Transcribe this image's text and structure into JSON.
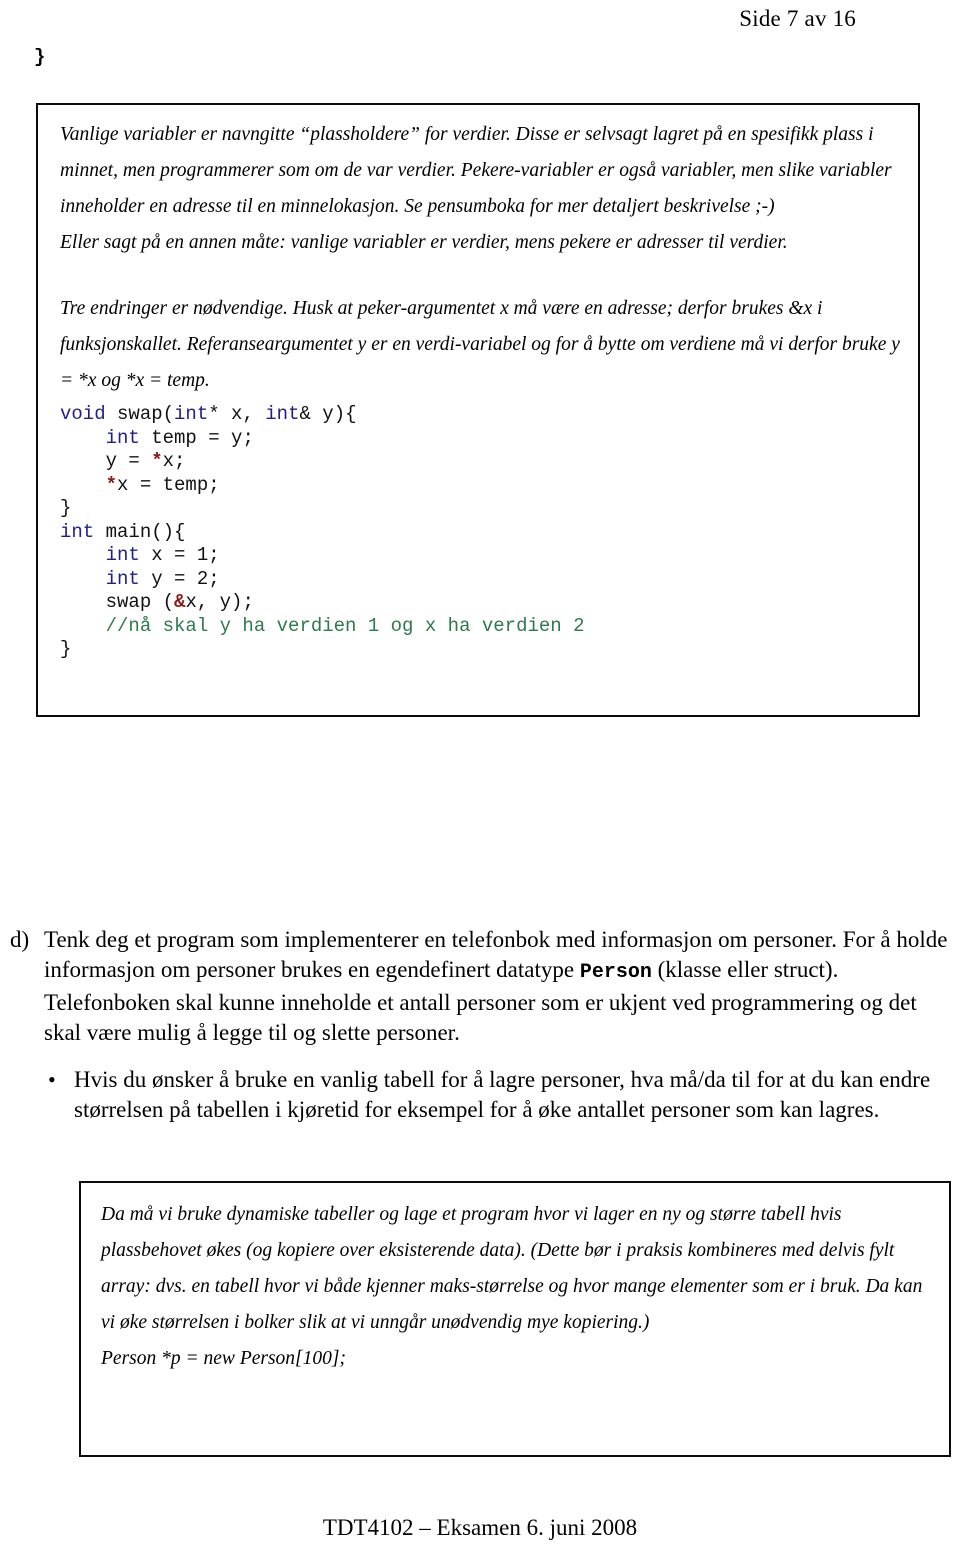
{
  "header": {
    "page_label": "Side 7 av 16"
  },
  "stray_code": {
    "closing_brace": "}"
  },
  "answer_box_top": {
    "paragraphs": [
      "Vanlige variabler er navngitte “plassholdere” for verdier. Disse er selvsagt lagret på en spesifikk plass i minnet, men programmerer som om de var verdier. Pekere-variabler er også variabler, men slike variabler inneholder en adresse til en minnelokasjon. Se pensumboka for mer detaljert beskrivelse ;-)",
      "Eller sagt på en annen måte: vanlige variabler er verdier, mens pekere er adresser til verdier.",
      "Tre endringer er nødvendige. Husk at peker-argumentet x må være en adresse; derfor brukes &x i funksjonskallet. Referanseargumentet y er en verdi-variabel og for å bytte om verdiene må vi derfor bruke y = *x og *x = temp."
    ],
    "code": {
      "lines": [
        [
          {
            "t": "void",
            "c": "kw"
          },
          {
            "t": " swap(",
            "c": ""
          },
          {
            "t": "int",
            "c": "kw"
          },
          {
            "t": "* x, ",
            "c": ""
          },
          {
            "t": "int",
            "c": "kw"
          },
          {
            "t": "& y){",
            "c": ""
          }
        ],
        [
          {
            "t": "    ",
            "c": ""
          },
          {
            "t": "int",
            "c": "kw"
          },
          {
            "t": " temp = y;",
            "c": ""
          }
        ],
        [
          {
            "t": "    y = ",
            "c": ""
          },
          {
            "t": "*",
            "c": "op"
          },
          {
            "t": "x;",
            "c": ""
          }
        ],
        [
          {
            "t": "    ",
            "c": ""
          },
          {
            "t": "*",
            "c": "op"
          },
          {
            "t": "x = temp;",
            "c": ""
          }
        ],
        [
          {
            "t": "}",
            "c": ""
          }
        ],
        [
          {
            "t": "int",
            "c": "kw"
          },
          {
            "t": " main(){",
            "c": ""
          }
        ],
        [
          {
            "t": "    ",
            "c": ""
          },
          {
            "t": "int",
            "c": "kw"
          },
          {
            "t": " x = 1;",
            "c": ""
          }
        ],
        [
          {
            "t": "    ",
            "c": ""
          },
          {
            "t": "int",
            "c": "kw"
          },
          {
            "t": " y = 2;",
            "c": ""
          }
        ],
        [
          {
            "t": "    swap (",
            "c": ""
          },
          {
            "t": "&",
            "c": "op"
          },
          {
            "t": "x, y);",
            "c": ""
          }
        ],
        [
          {
            "t": "    //nå skal y ha verdien 1 og x ha verdien 2",
            "c": "cmt"
          }
        ],
        [
          {
            "t": "}",
            "c": ""
          }
        ]
      ]
    }
  },
  "task_d": {
    "letter": "d)",
    "text_before_mono": "Tenk deg et program som implementerer en telefonbok med informasjon om personer. For å holde informasjon om personer brukes en egendefinert datatype ",
    "mono_term": "Person",
    "text_after_mono": " (klasse eller struct). Telefonboken skal kunne inneholde et antall personer som er ukjent ved programmering og det skal være mulig å legge til og slette personer."
  },
  "bullet": {
    "marker": "•",
    "text": "Hvis du ønsker å bruke en vanlig tabell for å lagre personer, hva må/da til for at du kan endre størrelsen på tabellen i kjøretid for eksempel for å øke antallet personer som kan lagres."
  },
  "answer_box_bottom": {
    "paragraphs": [
      "Da må vi bruke dynamiske tabeller og lage et program hvor vi lager en ny og større tabell hvis plassbehovet økes (og kopiere over eksisterende data). (Dette bør i praksis kombineres med delvis fylt array: dvs. en tabell hvor vi både kjenner maks-størrelse og hvor mange elementer som er i bruk. Da kan vi øke størrelsen i bolker slik at vi unngår unødvendig mye kopiering.)",
      "Person *p = new Person[100];"
    ]
  },
  "footer": {
    "text": "TDT4102 – Eksamen 6. juni 2008"
  },
  "colors": {
    "keyword": "#1f1f8c",
    "operator": "#8b1a1a",
    "comment": "#2d7a4d",
    "border": "#0a0a0a",
    "text": "#000000"
  }
}
